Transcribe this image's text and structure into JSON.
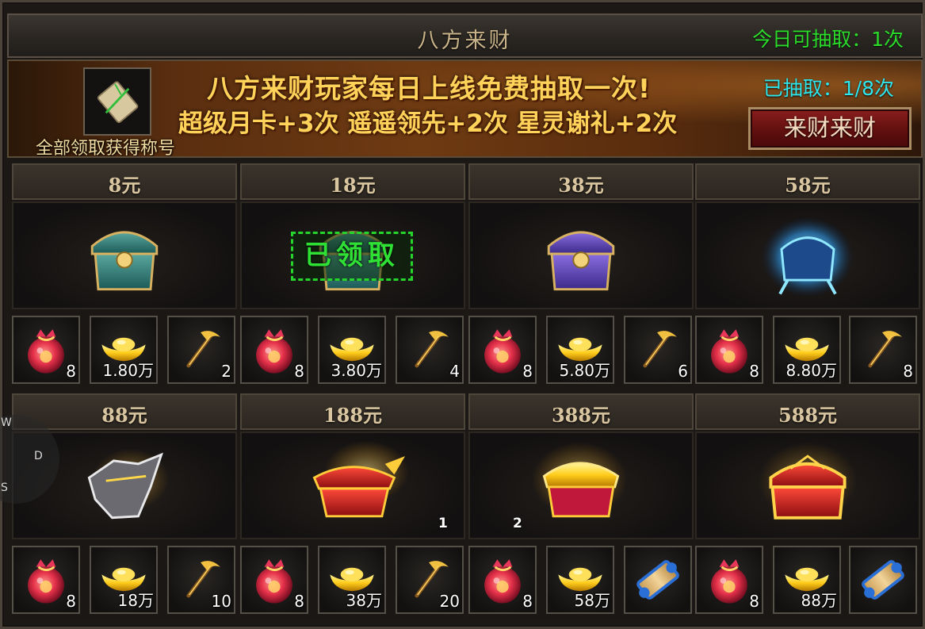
{
  "window": {
    "title": "八方来财",
    "draws_today": "今日可抽取：1次"
  },
  "banner": {
    "caption": "全部领取获得称号",
    "promo_line1": "八方来财玩家每日上线免费抽取一次!",
    "promo_line2": "超级月卡+3次 遥遥领先+2次 星灵谢礼+2次",
    "drawn": "已抽取：1/8次",
    "draw_button": "来财来财"
  },
  "tiers": [
    {
      "price": "8元",
      "rewards": [
        "8",
        "1.80万",
        "2"
      ]
    },
    {
      "price": "18元",
      "rewards": [
        "8",
        "3.80万",
        "4"
      ],
      "status": "已领取"
    },
    {
      "price": "38元",
      "rewards": [
        "8",
        "5.80万",
        "6"
      ]
    },
    {
      "price": "58元",
      "rewards": [
        "8",
        "8.80万",
        "8"
      ]
    },
    {
      "price": "88元",
      "rewards": [
        "8",
        "18万",
        "10"
      ]
    },
    {
      "price": "188元",
      "rewards": [
        "8",
        "38万",
        "20"
      ],
      "chest_tag": "1"
    },
    {
      "price": "388元",
      "rewards": [
        "8",
        "58万",
        ""
      ],
      "chest_tag": "2"
    },
    {
      "price": "588元",
      "rewards": [
        "8",
        "88万",
        ""
      ]
    }
  ],
  "hud": {
    "key_w": "W",
    "key_d": "D",
    "key_s": "S"
  },
  "colors": {
    "draws_green": "#2bdc2b",
    "drawn_cyan": "#2ee6ee",
    "promo_gold": "#ffd25a",
    "claimed_green": "#2fe035",
    "button_red": "#8a1e1e"
  },
  "icons": {
    "reward_1": "red-lucky-bag-icon",
    "reward_2": "gold-ingot-icon",
    "reward_3_low": "golden-pickaxe-icon",
    "reward_3_high": "blue-scroll-icon",
    "title_item": "green-scroll-icon"
  }
}
